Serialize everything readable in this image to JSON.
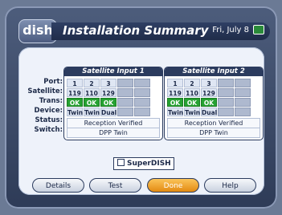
{
  "header": {
    "title": "Installation Summary",
    "date": "Fri, July 8",
    "logo_text": "dish"
  },
  "row_labels": [
    "Port:",
    "Satellite:",
    "Trans:",
    "Device:",
    "Status:",
    "Switch:"
  ],
  "inputs": [
    {
      "title": "Satellite Input 1",
      "ports": [
        "1",
        "2",
        "3",
        "",
        ""
      ],
      "satellites": [
        "119",
        "110",
        "129",
        "",
        ""
      ],
      "trans": [
        "OK",
        "OK",
        "OK",
        "",
        ""
      ],
      "devices": [
        "Twin",
        "Twin",
        "Dual",
        "",
        ""
      ],
      "status": "Reception Verified",
      "switch": "DPP Twin"
    },
    {
      "title": "Satellite Input 2",
      "ports": [
        "1",
        "2",
        "3",
        "",
        ""
      ],
      "satellites": [
        "119",
        "110",
        "129",
        "",
        ""
      ],
      "trans": [
        "OK",
        "OK",
        "OK",
        "",
        ""
      ],
      "devices": [
        "Twin",
        "Twin",
        "Dual",
        "",
        ""
      ],
      "status": "Reception Verified",
      "switch": "DPP Twin"
    }
  ],
  "superdish": {
    "label": "SuperDISH",
    "checked": false
  },
  "buttons": {
    "details": "Details",
    "test": "Test",
    "done": "Done",
    "help": "Help"
  },
  "colors": {
    "ok": "#26a232",
    "done": "#e38a12",
    "header": "#2b3b5e"
  }
}
